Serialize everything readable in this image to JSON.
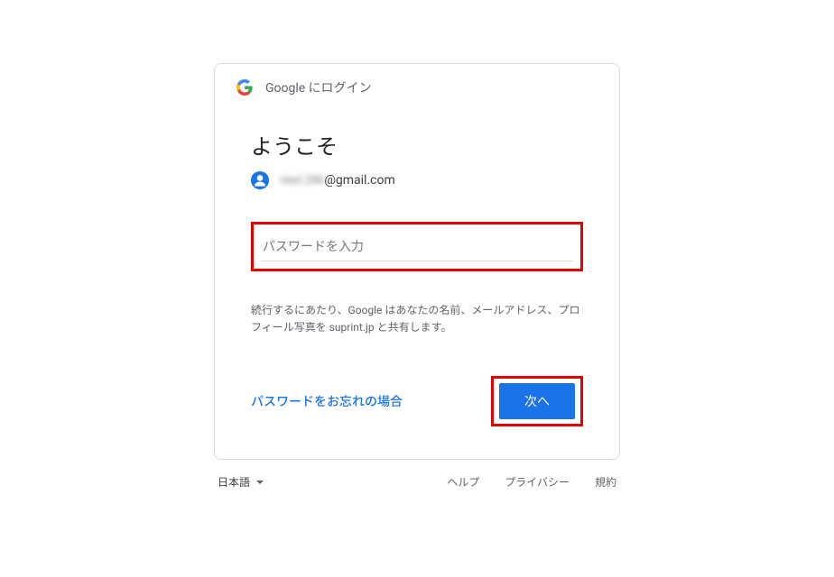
{
  "header": {
    "title": "Google にログイン"
  },
  "main": {
    "heading": "ようこそ",
    "email_masked": "nisri.286",
    "email_domain": "@gmail.com",
    "password_placeholder": "パスワードを入力",
    "disclosure": "続行するにあたり、Google はあなたの名前、メールアドレス、プロフィール写真を suprint.jp と共有します。",
    "forgot_label": "パスワードをお忘れの場合",
    "next_label": "次へ"
  },
  "footer": {
    "language": "日本語",
    "links": {
      "help": "ヘルプ",
      "privacy": "プライバシー",
      "terms": "規約"
    }
  }
}
